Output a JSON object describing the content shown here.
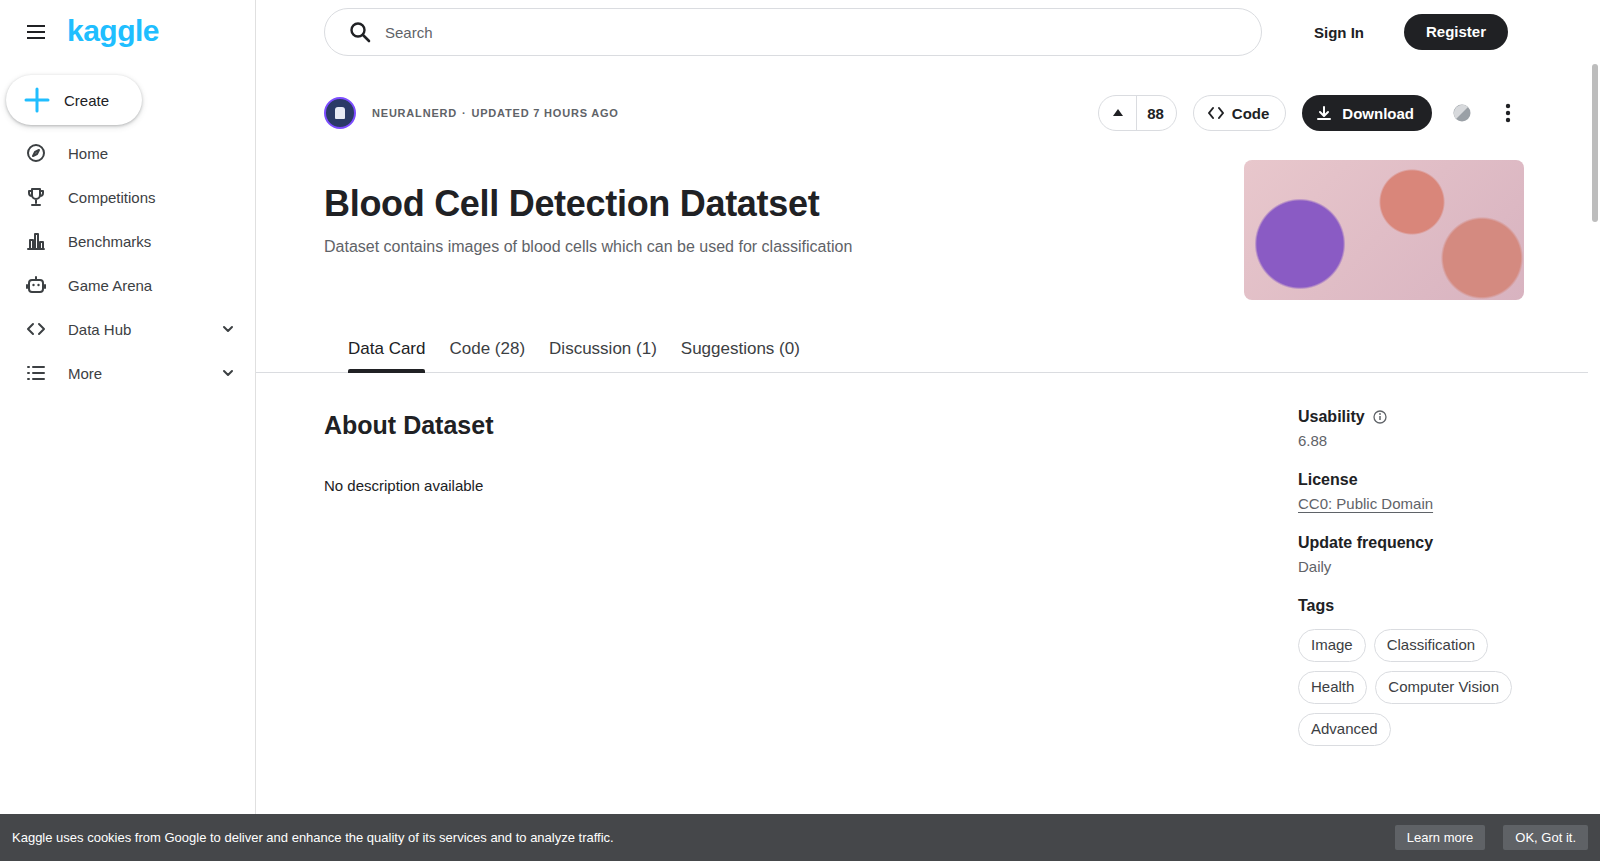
{
  "logo": "kaggle",
  "create": "Create",
  "nav": [
    {
      "label": "Home",
      "kind": "link"
    },
    {
      "label": "Competitions",
      "kind": "link"
    },
    {
      "label": "Benchmarks",
      "kind": "link"
    },
    {
      "label": "Game Arena",
      "kind": "link"
    },
    {
      "label": "Data Hub",
      "kind": "group",
      "expanded": false
    },
    {
      "label": "More",
      "kind": "group",
      "expanded": false
    }
  ],
  "search": {
    "placeholder": "Search"
  },
  "auth": {
    "sign_in": "Sign In",
    "register": "Register"
  },
  "dataset": {
    "author": "NEURALNERD",
    "separator": "·",
    "updated": "UPDATED 7 HOURS AGO",
    "votes": "88",
    "code_button": "Code",
    "download_button": "Download",
    "title": "Blood Cell Detection Datatset",
    "subtitle": "Dataset contains images of blood cells which can be used for classification"
  },
  "tabs": [
    {
      "label": "Data Card",
      "selected": true
    },
    {
      "label": "Code (28)",
      "selected": false
    },
    {
      "label": "Discussion (1)",
      "selected": false
    },
    {
      "label": "Suggestions (0)",
      "selected": false
    }
  ],
  "about": {
    "heading": "About Dataset",
    "description": "No description available"
  },
  "details": [
    {
      "label": "Usability",
      "value": "6.88",
      "kind": "info"
    },
    {
      "label": "License",
      "value": "CC0: Public Domain",
      "kind": "link"
    },
    {
      "label": "Update frequency",
      "value": "Daily",
      "kind": "text"
    }
  ],
  "tags": {
    "heading": "Tags",
    "items": [
      "Image",
      "Classification",
      "Health",
      "Computer Vision",
      "Advanced"
    ]
  },
  "cookie_banner": {
    "text": "Kaggle uses cookies from Google to deliver and enhance the quality of its services and to analyze traffic.",
    "buttons": [
      "Learn more",
      "OK, Got it."
    ]
  }
}
